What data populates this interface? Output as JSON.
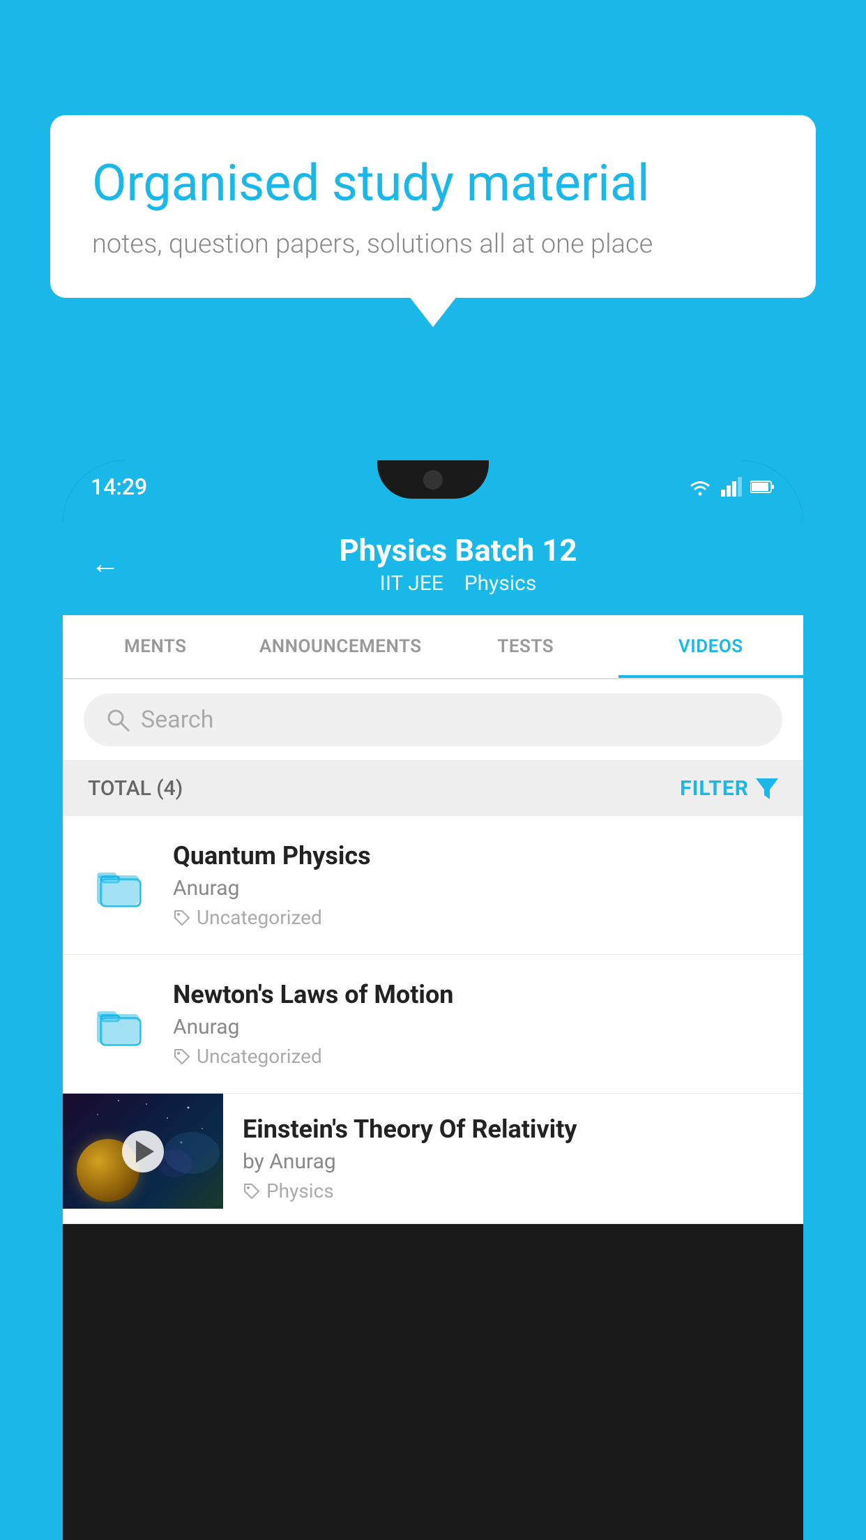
{
  "background_color": "#1ab8e8",
  "speech_bubble": {
    "title": "Organised study material",
    "subtitle": "notes, question papers, solutions all at one place"
  },
  "phone": {
    "status_bar": {
      "time": "14:29",
      "wifi_icon": "wifi",
      "signal_icon": "signal",
      "battery_icon": "battery"
    },
    "header": {
      "title": "Physics Batch 12",
      "subtitle_part1": "IIT JEE",
      "subtitle_part2": "Physics",
      "back_label": "back"
    },
    "tabs": [
      {
        "label": "MENTS",
        "active": false
      },
      {
        "label": "ANNOUNCEMENTS",
        "active": false
      },
      {
        "label": "TESTS",
        "active": false
      },
      {
        "label": "VIDEOS",
        "active": true
      }
    ],
    "search": {
      "placeholder": "Search"
    },
    "filter_bar": {
      "total_label": "TOTAL (4)",
      "filter_label": "FILTER"
    },
    "list_items": [
      {
        "type": "folder",
        "title": "Quantum Physics",
        "author": "Anurag",
        "tag": "Uncategorized"
      },
      {
        "type": "folder",
        "title": "Newton's Laws of Motion",
        "author": "Anurag",
        "tag": "Uncategorized"
      }
    ],
    "video_item": {
      "type": "video",
      "title": "Einstein's Theory Of Relativity",
      "author": "by Anurag",
      "tag": "Physics"
    }
  }
}
